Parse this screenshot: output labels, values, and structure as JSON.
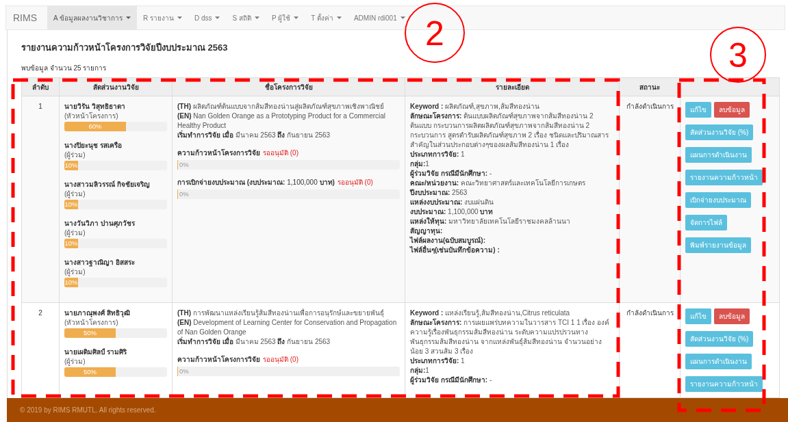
{
  "nav": {
    "brand": "RIMS",
    "menus": [
      {
        "label": "A ข้อมูลผลงานวิชาการ",
        "selected": true
      },
      {
        "label": "R รายงาน",
        "selected": false
      },
      {
        "label": "D dss",
        "selected": false
      },
      {
        "label": "S สถิติ",
        "selected": false
      },
      {
        "label": "P ผู้ใช้",
        "selected": false
      },
      {
        "label": "T ตั้งค่า",
        "selected": false
      },
      {
        "label": "ADMIN rdi001",
        "selected": false
      }
    ]
  },
  "title": "รายงานความก้าวหน้าโครงการวิจัยปีงบประมาณ 2563",
  "count_text": "พบข้อมูล จำนวน 25 รายการ",
  "table": {
    "columns": [
      "ลำดับ",
      "สัดส่วนงานวิจัย",
      "ชื่อโครงการวิจัย",
      "รายละเอียด",
      "สถานะ"
    ],
    "rows": [
      {
        "no": "1",
        "members": [
          {
            "name": "นายวิรัน วิสุทธิธาดา",
            "role": "(หัวหน้าโครงการ)",
            "level": 0.6,
            "reading": "60%"
          },
          {
            "name": "นางปิยะนุช รสเครือ",
            "role": "(ผู้ร่วม)",
            "level": 0.1,
            "reading": "10%"
          },
          {
            "name": "นางสาวมลิวรรณ์ กิจชัยเจริญ",
            "role": "(ผู้ร่วม)",
            "level": 0.1,
            "reading": "10%"
          },
          {
            "name": "นางวันวิภา ปานศุภวัชร",
            "role": "(ผู้ร่วม)",
            "level": 0.1,
            "reading": "10%"
          },
          {
            "name": "นางสาวฐาณิญา อิสสระ",
            "role": "(ผู้ร่วม)",
            "level": 0.1,
            "reading": "10%"
          }
        ],
        "project": {
          "th": "**(TH)** ผลิตภัณฑ์ต้นแบบจากส้มสีทองน่านสู่ผลิตภัณฑ์สุขภาพเชิงพาณิชย์",
          "en": "**(EN)** Nan Golden Orange as a Prototyping Product for a Commercial Healthy Product",
          "period": "**เริ่มทำการวิจัย เมื่อ** มีนาคม 2563 **ถึง** กันยายน 2563",
          "progress": {
            "label": "ความก้าวหน้าโครงการวิจัย",
            "status": "รออนุมัติ (0)",
            "level": 0,
            "reading": "0%"
          },
          "budget": {
            "label": "**การเบิกจ่ายงบประมาณ (งบประมาณ:** 1,100,000 **บาท)**",
            "status": "รออนุมัติ (0)",
            "level": 0,
            "reading": "0%"
          }
        },
        "details": [
          {
            "text": "**Keyword :** ผลิตภัณฑ์,สุขภาพ,ส้มสีทองน่าน"
          },
          {
            "text": "**ลักษณะโครงการ:** ต้นแบบผลิตภัณฑ์สุขภาพจากส้มสีทองน่าน 2 ต้นแบบ กระบวนการผลิตผลิตภัณฑ์สุขภาพจากส้มสีทองน่าน 2 กระบวนการ สูตรตำรับผลิตภัณฑ์สุขภาพ 2 เรื่อง ชนิดและปริมาณสารสำคัญในส่วนประกอบต่างๆของผลส้มสีทองน่าน 1 เรื่อง"
          },
          {
            "text": "**ประเภทการวิจัย:** 1"
          },
          {
            "text": "**กลุ่ม:**1"
          },
          {
            "text": "**ผู้ร่วมวิจัย กรณีมีนักศึกษา:** -"
          },
          {
            "text": "**คณะ/หน่วยงาน:** คณะวิทยาศาสตร์และเทคโนโลยีการเกษตร"
          },
          {
            "text": "**ปีงบประมาณ:** 2563"
          },
          {
            "text": "**แหล่งงบประมาณ:** งบแผ่นดิน"
          },
          {
            "text": "**งบประมาณ:** 1,100,000 **บาท**"
          },
          {
            "text": "**แหล่งให้ทุน:** มหาวิทยาลัยเทคโนโลยีราชมงคลล้านนา"
          },
          {
            "label": "สัญญาทุน:"
          },
          {
            "label": "ไฟล์ผลงาน(ฉบับสมบูรณ์):"
          },
          {
            "label": "ไฟล์อื่นๆ(เช่นบันทึกข้อความ) :"
          }
        ],
        "status": "กำลังดำเนินการ",
        "buttons": [
          {
            "label": "แก้ไข",
            "kind": "info"
          },
          {
            "label": "ลบข้อมูล",
            "kind": "danger"
          },
          {
            "label": "สัดส่วนงานวิจัย (%)",
            "kind": "info"
          },
          {
            "label": "แผนการดำเนินงาน",
            "kind": "info"
          },
          {
            "label": "รายงานความก้าวหน้า",
            "kind": "info"
          },
          {
            "label": "เบิกจ่ายงบประมาณ",
            "kind": "info"
          },
          {
            "label": "จัดการไฟล์",
            "kind": "info"
          },
          {
            "label": "พิมพ์รายงานข้อมูล",
            "kind": "info"
          }
        ]
      },
      {
        "no": "2",
        "members": [
          {
            "name": "นายภาณุพงศ์ สิทธิวุฒิ",
            "role": "(หัวหน้าโครงการ)",
            "level": 0.5,
            "reading": "50%"
          },
          {
            "name": "นายเผดิมศิลป์ รามศิริ",
            "role": "(ผู้ร่วม)",
            "level": 0.5,
            "reading": "50%"
          }
        ],
        "project": {
          "th": "**(TH)** การพัฒนาแหล่งเรียนรู้ส้มสีทองน่านเพื่อการอนุรักษ์และขยายพันธุ์",
          "en": "**(EN)** Development of Learning Center for Conservation and Propagation of Nan Golden Orange",
          "period": "**เริ่มทำการวิจัย เมื่อ** มีนาคม 2563 **ถึง** กันยายน 2563",
          "progress": {
            "label": "ความก้าวหน้าโครงการวิจัย",
            "status": "รออนุมัติ (0)",
            "level": 0,
            "reading": "0%"
          }
        },
        "details": [
          {
            "text": "**Keyword :** แหล่งเรียนรู้,ส้มสีทองน่าน,Citrus reticulata"
          },
          {
            "text": "**ลักษณะโครงการ:** การเผยแพร่บทความในวารสาร TCI 1 1 เรื่อง องค์ความรู้เรื่องพันธุกรรมส้มสีทองน่าน ระดับความแปรปรวนทางพันธุกรรมส้มสีทองน่าน จากแหล่งพันธุ์ส้มสีทองน่าน จำนวนอย่างน้อย 3 สวนส้ม 3 เรื่อง"
          },
          {
            "text": "**ประเภทการวิจัย:** 1"
          },
          {
            "text": "**กลุ่ม:**1"
          },
          {
            "text": "**ผู้ร่วมวิจัย กรณีมีนักศึกษา:** -"
          }
        ],
        "status": "กำลังดำเนินการ",
        "buttons": [
          {
            "label": "แก้ไข",
            "kind": "info"
          },
          {
            "label": "ลบข้อมูล",
            "kind": "danger"
          },
          {
            "label": "สัดส่วนงานวิจัย (%)",
            "kind": "info"
          },
          {
            "label": "แผนการดำเนินงาน",
            "kind": "info"
          },
          {
            "label": "รายงานความก้าวหน้า",
            "kind": "info"
          }
        ]
      }
    ]
  },
  "footer": "© 2019 by RIMS RMUTL. All rights reserved.",
  "annotations": [
    {
      "label": "2"
    },
    {
      "label": "3"
    }
  ]
}
